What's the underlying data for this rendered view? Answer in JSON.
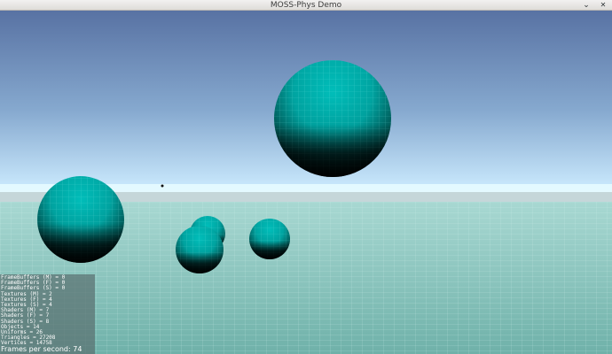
{
  "window": {
    "title": "MOSS-Phys Demo",
    "minimize_glyph": "⌄",
    "close_glyph": "✕"
  },
  "scene": {
    "sky_top": "#5872a3",
    "sky_horizon": "#cdecff",
    "ground_far": "#a8d8d2",
    "ground_near": "#6fb1a9",
    "sphere_color": "#00b3b0",
    "spheres": [
      {
        "id": "large-floating"
      },
      {
        "id": "left"
      },
      {
        "id": "center-back"
      },
      {
        "id": "center-front"
      },
      {
        "id": "right-small"
      }
    ]
  },
  "stats": {
    "lines": [
      "FrameBuffers (M) = 0",
      "FrameBuffers (F) = 0",
      "FrameBuffers (S) = 0",
      "Textures (M) = 2",
      "Textures (F) = 4",
      "Textures (S) = 4",
      "Shaders (M) = 7",
      "Shaders (F) = 7",
      "Shaders (S) = 8",
      "Objects = 14",
      "Uniforms = 26",
      "Triangles = 27208",
      "Vertices = 14758"
    ],
    "fps": "Frames per second: 74"
  }
}
